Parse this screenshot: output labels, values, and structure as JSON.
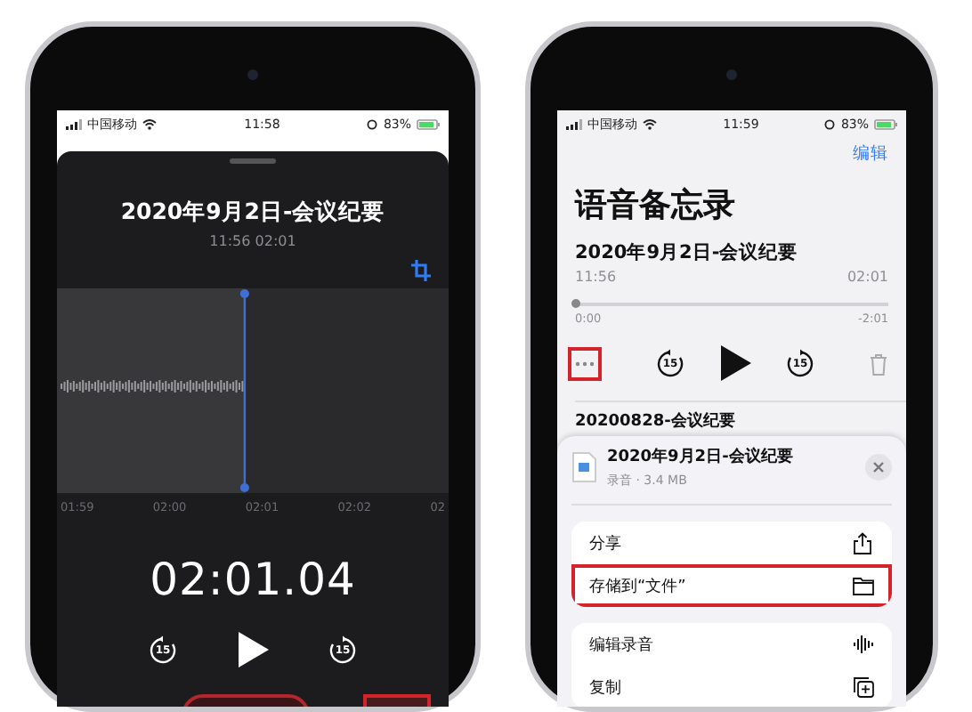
{
  "left_phone": {
    "status_bar": {
      "carrier": "中国移动",
      "time": "11:58",
      "battery": "83%"
    },
    "editor": {
      "title": "2020年9月2日-会议纪要",
      "subtitle": "11:56  02:01",
      "timeline": [
        "01:59",
        "02:00",
        "02:01",
        "02:02",
        "02"
      ],
      "elapsed": "02:01.04",
      "skip_back": "15",
      "skip_forward": "15"
    }
  },
  "right_phone": {
    "status_bar": {
      "carrier": "中国移动",
      "time": "11:59",
      "battery": "83%"
    },
    "edit": "编辑",
    "heading": "语音备忘录",
    "recording": {
      "title": "2020年9月2日-会议纪要",
      "time": "11:56",
      "duration": "02:01",
      "scrubber": {
        "level": 0,
        "start": "0:00",
        "end": "-2:01"
      },
      "skip_back": "15",
      "skip_forward": "15",
      "more_highlighted": true
    },
    "next_recording": "20200828-会议纪要",
    "share_sheet": {
      "file_title": "2020年9月2日-会议纪要",
      "file_info": "录音 · 3.4 MB",
      "groups": [
        [
          {
            "label": "分享",
            "kind": "share",
            "highlighted": false
          },
          {
            "label": "存储到“文件”",
            "kind": "folder",
            "highlighted": true
          }
        ],
        [
          {
            "label": "编辑录音",
            "kind": "waveform",
            "highlighted": false
          },
          {
            "label": "复制",
            "kind": "duplicate",
            "highlighted": false
          }
        ]
      ]
    }
  }
}
